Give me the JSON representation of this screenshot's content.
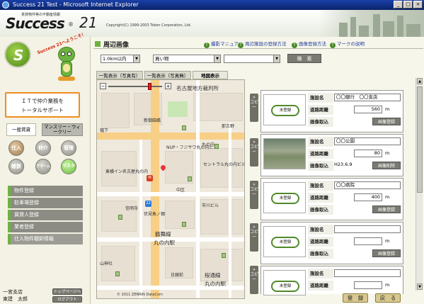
{
  "window": {
    "title": "Success 21 Test - Microsoft Internet Explorer"
  },
  "header": {
    "tagline": "賃貸物件等の不動産情報",
    "logo": "Success",
    "logo_number": "21",
    "logo_mark": "®",
    "copyright": "Copyright(C) 1999-2003 Token Corporation, Ltd."
  },
  "sidebar": {
    "welcome": "Success 21へようこそ！",
    "slogan_line1": "ＩＴで仲介業務を",
    "slogan_line2": "トータルサポート",
    "category_tabs": [
      {
        "label": "一般賃貸"
      },
      {
        "label": "マンスリー・ウィークリー"
      }
    ],
    "circle_buttons": [
      "仕入",
      "仲介",
      "管理",
      "帳票",
      "アラーム",
      "マスタ"
    ],
    "menu": [
      "物件登録",
      "駐車場登録",
      "賃貸人登録",
      "業者登録",
      "仕入物件棚卸情報"
    ],
    "user": {
      "branch": "一宮支店",
      "name": "東建　太郎"
    },
    "toppage_label": "トップページへ",
    "logout_label": "ログアウト"
  },
  "main": {
    "section_title": "周辺画像",
    "help_links": [
      {
        "label": "撮影マニュアル"
      },
      {
        "label": "周辺施設の登録方法"
      },
      {
        "label": "画像登録方法"
      },
      {
        "label": "マークの説明"
      }
    ],
    "filters": {
      "distance": "1.0km以内",
      "category": "買い物",
      "extra": "",
      "search_label": "検　索"
    },
    "map_tabs": [
      {
        "label": "一覧表示（写真有）"
      },
      {
        "label": "一覧表示（写真無）"
      },
      {
        "label": "地図表示"
      }
    ],
    "map_labels": [
      "名古屋地方裁判所",
      "新御園橋",
      "那古野",
      "幅下",
      "丸の内",
      "NUP・フジサワ丸の内ビル",
      "東横イン名古屋丸の内",
      "セントラル丸の内ビル",
      "中区",
      "信明寺",
      "伏見魚ノ棚",
      "鶴舞線",
      "丸の内駅",
      "市川ビル",
      "桜通線",
      "丸の内駅",
      "山神社",
      "日銀前",
      "© 2011 ZENRIN DataCom"
    ],
    "copy_label": "コピー",
    "field_labels": {
      "name": "施設名",
      "distance": "道路距離",
      "image": "画像取込"
    },
    "unit": "m",
    "no_image_label": "未登録",
    "register_image_label": "画像登録",
    "delete_image_label": "画像削除",
    "facilities": [
      {
        "name": "〇〇銀行　〇〇支店",
        "distance": "560",
        "image_status": "未登録",
        "image_date": "",
        "action": "画像登録"
      },
      {
        "name": "〇〇公園",
        "distance": "80",
        "image_status": "photo",
        "image_date": "H23.6.9",
        "action": "画像削除"
      },
      {
        "name": "〇〇病院",
        "distance": "400",
        "image_status": "未登録",
        "image_date": "",
        "action": "画像登録"
      },
      {
        "name": "",
        "distance": "",
        "image_status": "未登録",
        "image_date": "",
        "action": "画像登録"
      },
      {
        "name": "",
        "distance": "",
        "image_status": "未登録",
        "image_date": "",
        "action": "画像登録"
      }
    ],
    "footer": {
      "register_label": "登　録",
      "back_label": "戻　る"
    }
  }
}
